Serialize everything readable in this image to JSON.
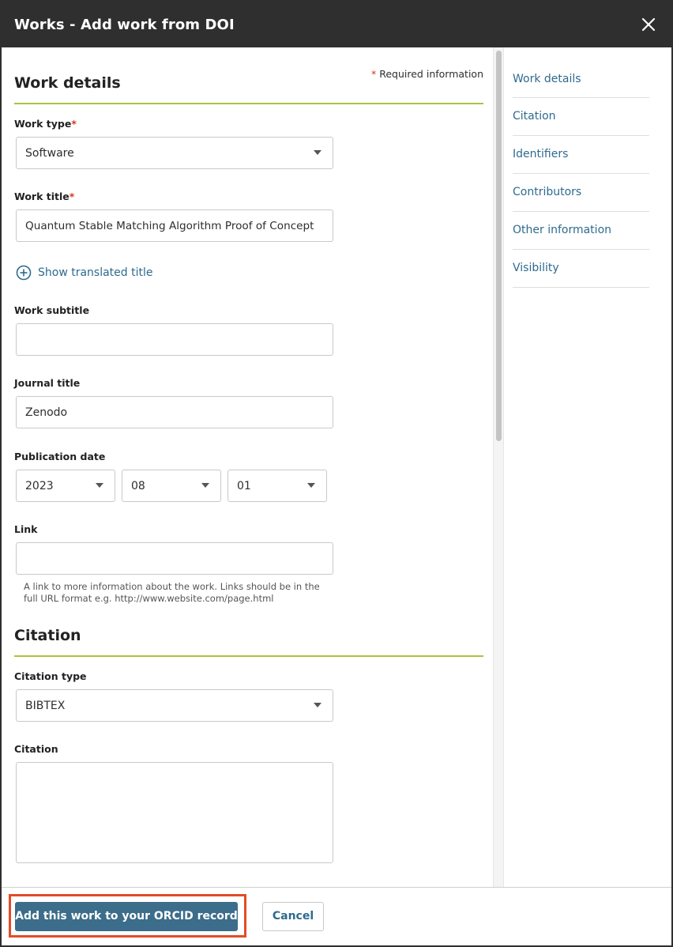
{
  "dialog": {
    "title": "Works - Add work from DOI"
  },
  "form": {
    "required_mark": "*",
    "required_note": "Required information",
    "work_details": {
      "heading": "Work details",
      "work_type": {
        "label": "Work type",
        "value": "Software"
      },
      "work_title": {
        "label": "Work title",
        "value": "Quantum Stable Matching Algorithm Proof of Concept"
      },
      "show_translated_title": "Show translated title",
      "work_subtitle": {
        "label": "Work subtitle",
        "value": ""
      },
      "journal_title": {
        "label": "Journal title",
        "value": "Zenodo"
      },
      "publication_date": {
        "label": "Publication date",
        "year": "2023",
        "month": "08",
        "day": "01"
      },
      "link": {
        "label": "Link",
        "value": "",
        "helper": "A link to more information about the work. Links should be in the full URL format e.g. http://www.website.com/page.html"
      }
    },
    "citation": {
      "heading": "Citation",
      "citation_type": {
        "label": "Citation type",
        "value": "BIBTEX"
      },
      "citation_text": {
        "label": "Citation",
        "value": ""
      }
    }
  },
  "sidenav": {
    "items": [
      {
        "label": "Work details"
      },
      {
        "label": "Citation"
      },
      {
        "label": "Identifiers"
      },
      {
        "label": "Contributors"
      },
      {
        "label": "Other information"
      },
      {
        "label": "Visibility"
      }
    ]
  },
  "footer": {
    "add_button": "Add this work to your ORCID record",
    "cancel_button": "Cancel"
  },
  "colors": {
    "titlebar": "#2f2f2f",
    "accent_divider": "#a9c43e",
    "link": "#2e6a8e",
    "primary_button": "#3c6d8b",
    "required": "#d0391b",
    "highlight": "#e34c26"
  },
  "icons": {
    "close": "close-icon",
    "add": "plus-circle-icon",
    "dropdown": "caret-down-icon"
  }
}
